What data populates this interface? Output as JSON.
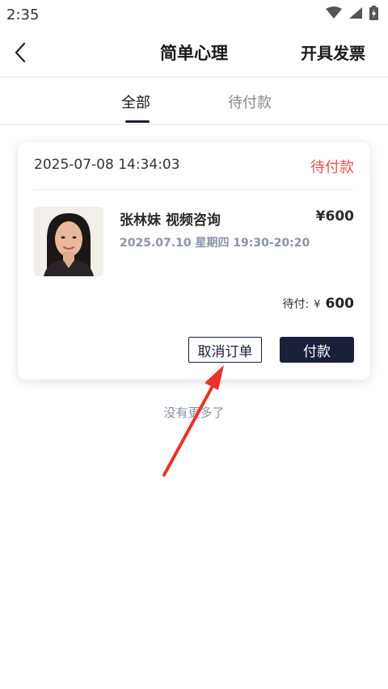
{
  "status_bar": {
    "time": "2:35",
    "icons": [
      "wifi-icon",
      "signal-icon",
      "battery-charging-icon"
    ]
  },
  "header": {
    "title": "简单心理",
    "back_icon": "chevron-left-icon",
    "invoice_label": "开具发票"
  },
  "tabs": [
    {
      "label": "全部",
      "active": true
    },
    {
      "label": "待付款",
      "active": false
    }
  ],
  "orders": [
    {
      "created_at": "2025-07-08 14:34:03",
      "status": "待付款",
      "counselor_service": "张林妹 视频咨询",
      "price": "¥600",
      "schedule": "2025.07.10 星期四 19:30-20:20",
      "due_label": "待付:",
      "due_currency": "¥",
      "due_amount": "600",
      "cancel_label": "取消订单",
      "pay_label": "付款"
    }
  ],
  "footer_note": "没有更多了",
  "colors": {
    "accent_navy": "#1a1f3a",
    "status_red": "#e8524e",
    "muted_blue_gray": "#8a93a8",
    "annotation_red": "#e8322a"
  }
}
